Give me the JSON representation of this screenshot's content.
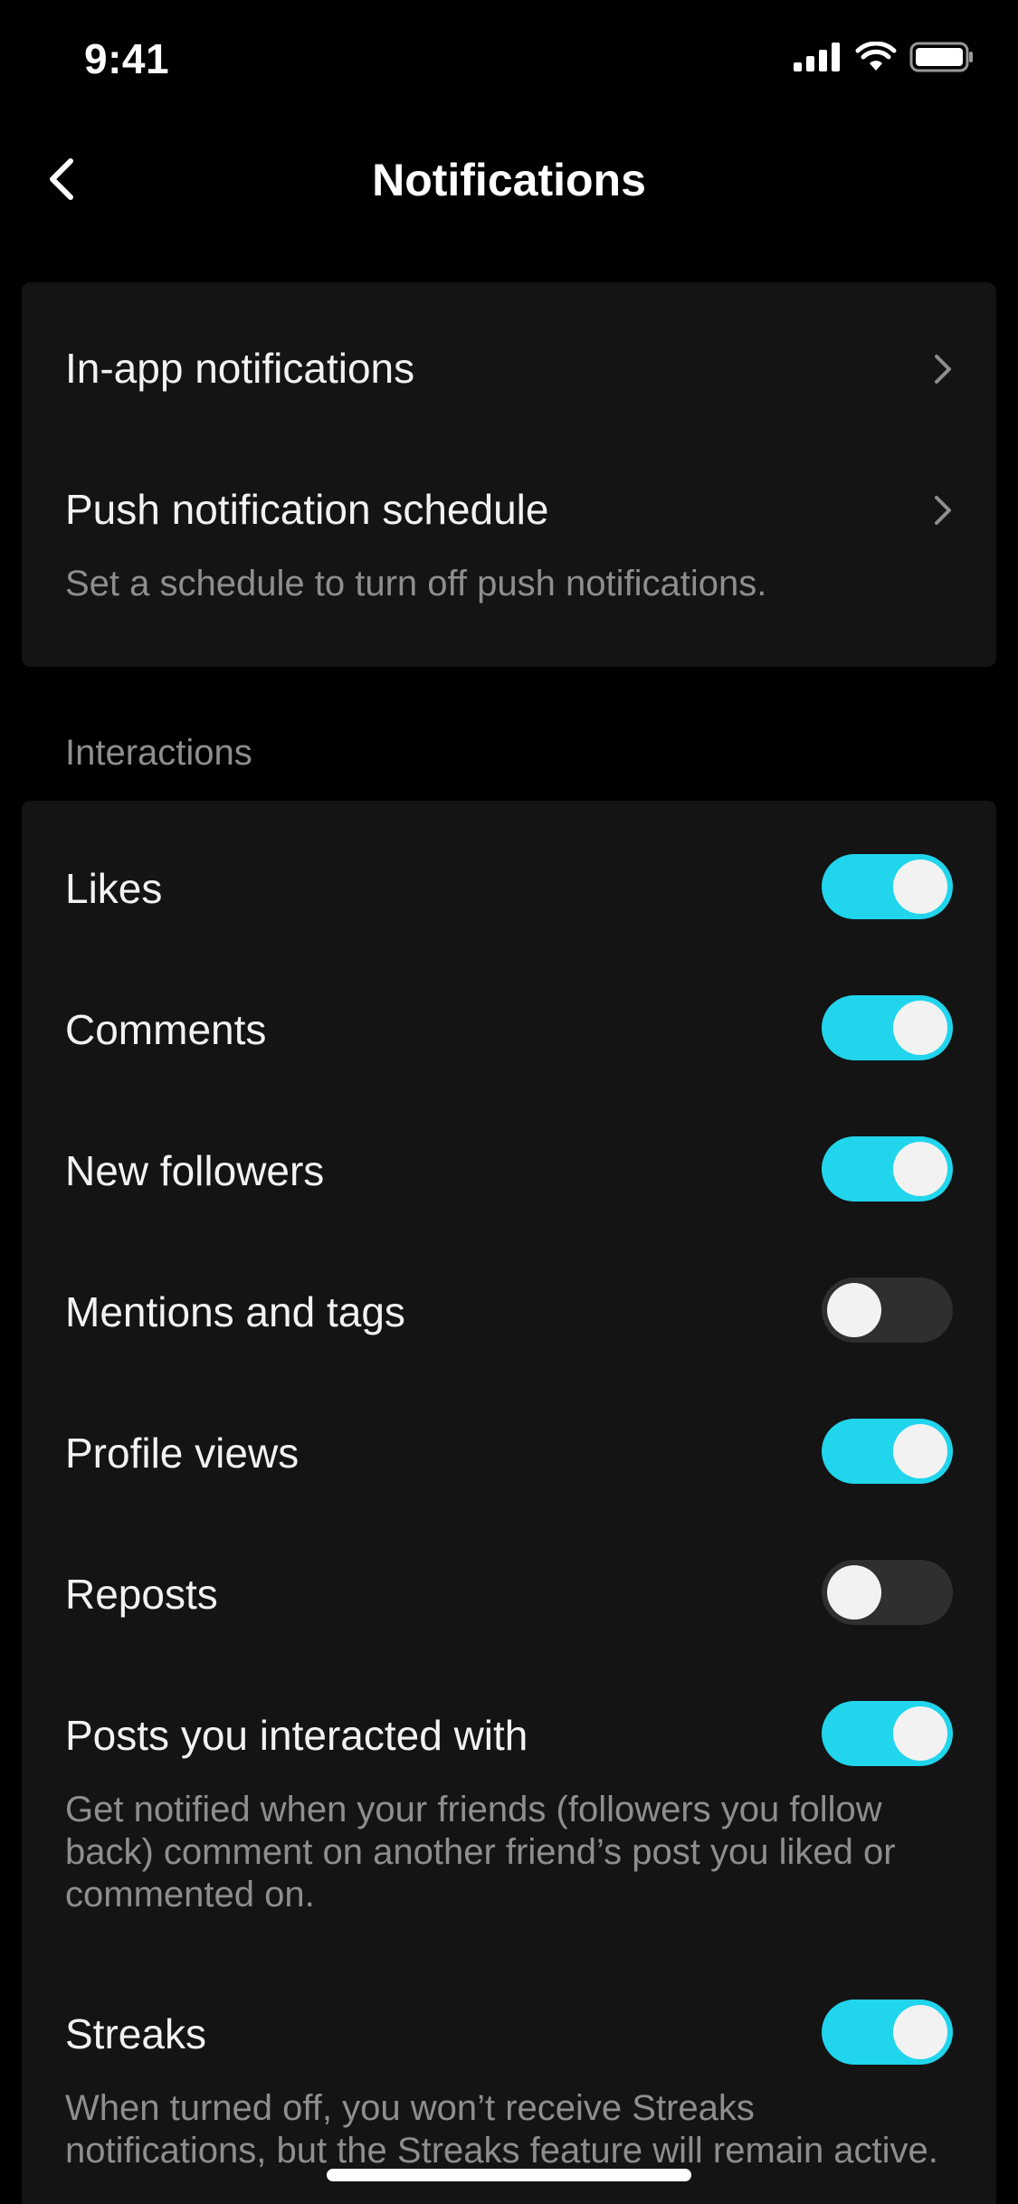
{
  "status_bar": {
    "time": "9:41"
  },
  "nav": {
    "title": "Notifications"
  },
  "menu": [
    {
      "title": "In-app notifications"
    },
    {
      "title": "Push notification schedule",
      "description": "Set a schedule to turn off push notifications."
    }
  ],
  "interactions": {
    "label": "Interactions",
    "items": [
      {
        "title": "Likes",
        "on": true
      },
      {
        "title": "Comments",
        "on": true
      },
      {
        "title": "New followers",
        "on": true
      },
      {
        "title": "Mentions and tags",
        "on": false
      },
      {
        "title": "Profile views",
        "on": true
      },
      {
        "title": "Reposts",
        "on": false
      },
      {
        "title": "Posts you interacted with",
        "on": true,
        "description": "Get notified when your friends (followers you follow back) comment on another friend’s post you liked or commented on."
      },
      {
        "title": "Streaks",
        "on": true,
        "description": "When turned off, you won’t receive Streaks notifications, but the Streaks feature will remain active."
      }
    ]
  },
  "colors": {
    "accent": "#20d5ec",
    "toggle_off": "#2f2f2f",
    "card": "#141414",
    "secondary_text": "#8e8e8e"
  },
  "icons": {
    "back": "chevron-left-icon",
    "chevron": "chevron-right-icon",
    "signal": "cellular-signal-icon",
    "wifi": "wifi-icon",
    "battery": "battery-icon"
  }
}
